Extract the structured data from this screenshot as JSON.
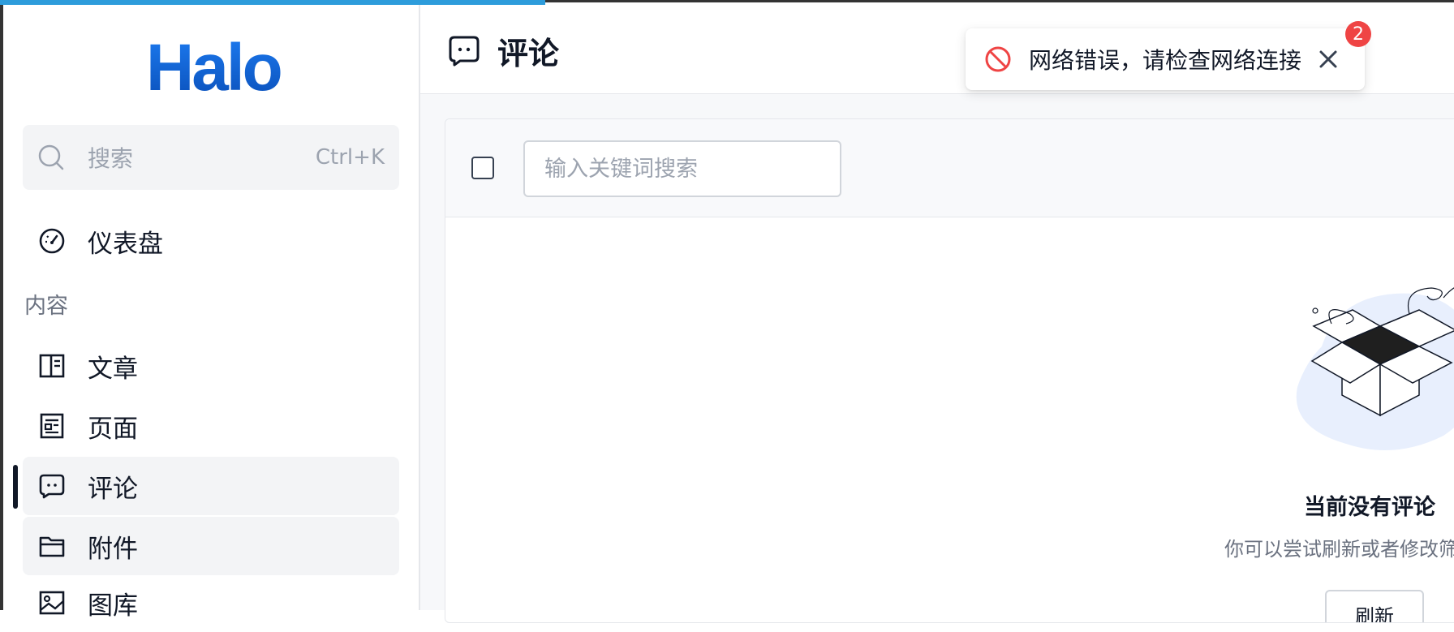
{
  "app": {
    "logo_text": "Halo",
    "brand_color": "#1a6fd8"
  },
  "sidebar": {
    "search": {
      "placeholder": "搜索",
      "shortcut": "Ctrl+K"
    },
    "items": [
      {
        "label": "仪表盘",
        "icon": "dashboard-icon"
      },
      {
        "section": "内容"
      },
      {
        "label": "文章",
        "icon": "article-icon"
      },
      {
        "label": "页面",
        "icon": "page-icon"
      },
      {
        "label": "评论",
        "icon": "comment-icon",
        "active": true
      },
      {
        "label": "附件",
        "icon": "folder-icon"
      },
      {
        "label": "图库",
        "icon": "image-icon"
      }
    ]
  },
  "header": {
    "title": "评论",
    "icon": "comment-icon"
  },
  "toolbar": {
    "search_placeholder": "输入关键词搜索"
  },
  "empty_state": {
    "title": "当前没有评论",
    "description": "你可以尝试刷新或者修改筛",
    "refresh_label": "刷新"
  },
  "toast": {
    "message": "网络错误，请检查网络连接",
    "count": "2",
    "type": "error",
    "error_color": "#ef4444"
  }
}
